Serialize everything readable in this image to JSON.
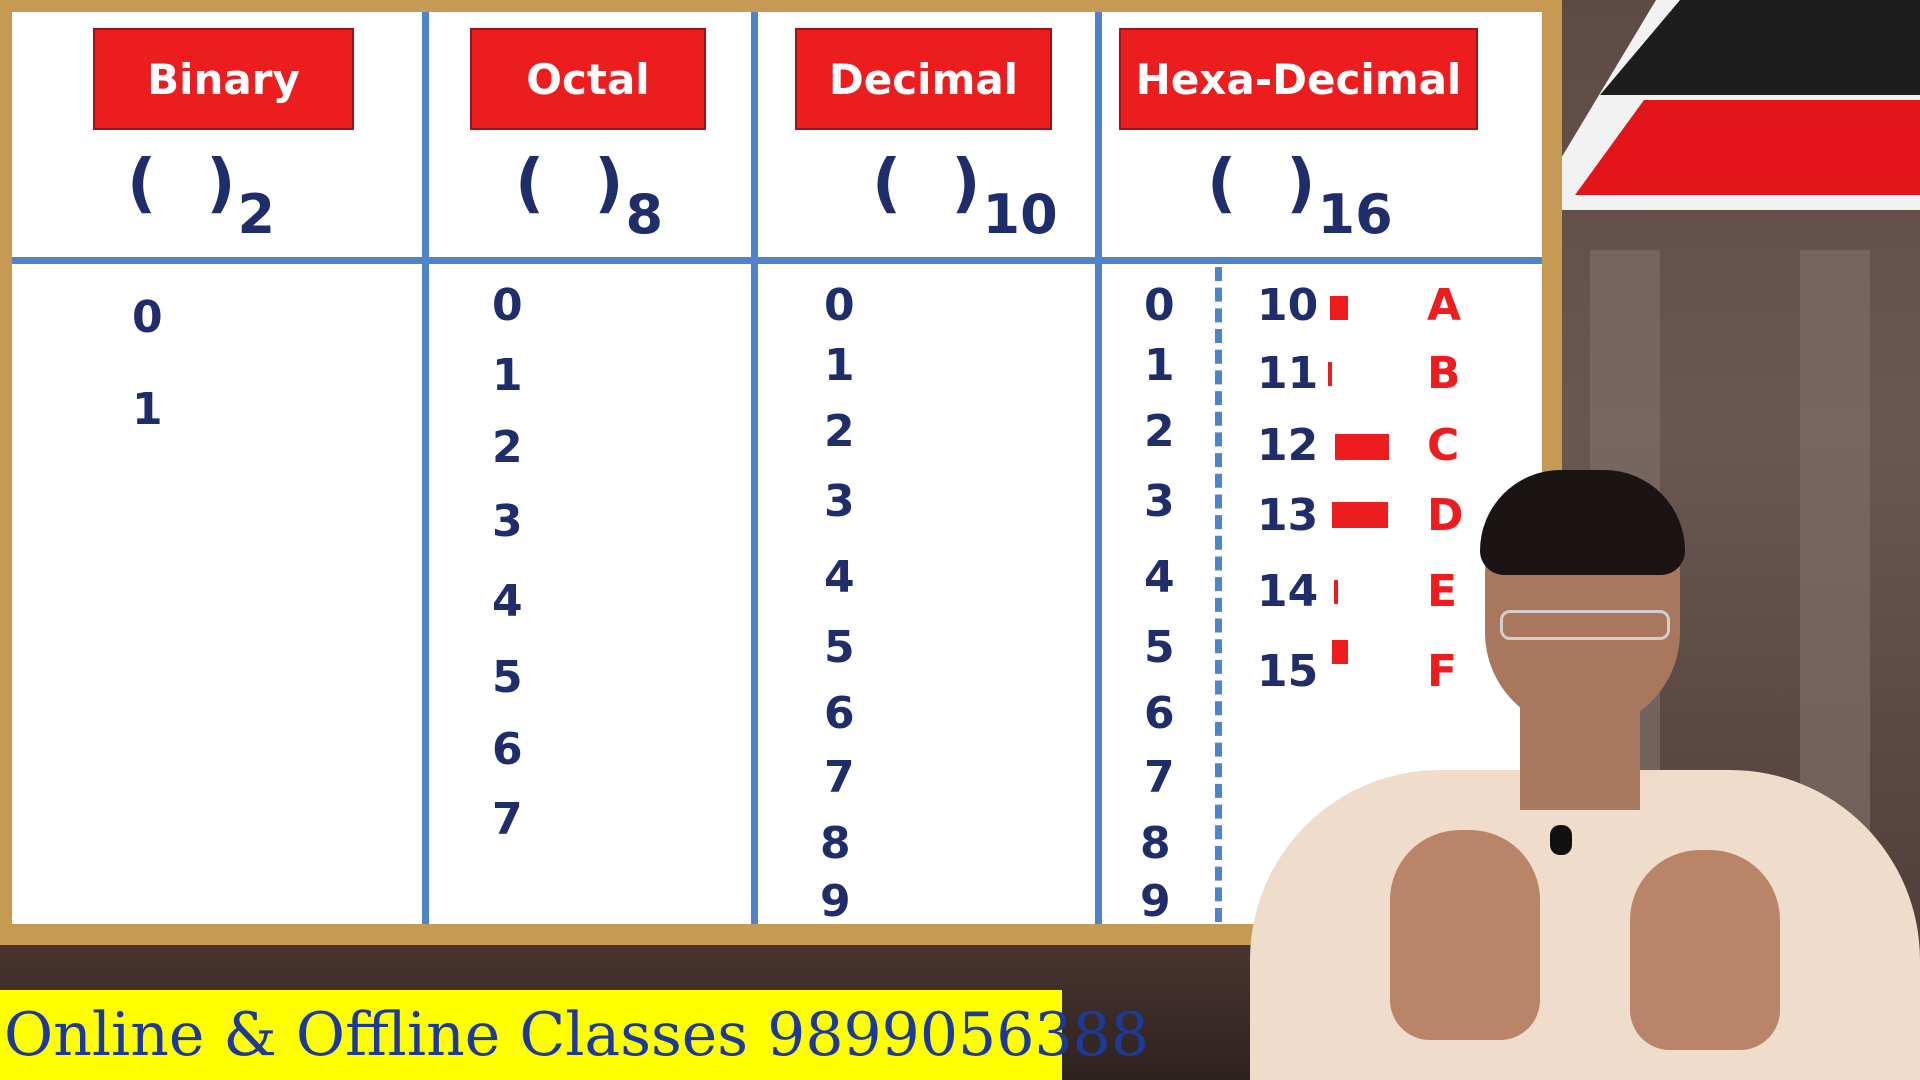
{
  "headers": {
    "binary": "Binary",
    "octal": "Octal",
    "decimal": "Decimal",
    "hex": "Hexa-Decimal"
  },
  "notation": {
    "open_paren": "(",
    "close_paren": ")",
    "binary_base": "2",
    "octal_base": "8",
    "decimal_base": "10",
    "hex_base": "16"
  },
  "binary_digits": [
    "0",
    "1"
  ],
  "octal_digits": [
    "0",
    "1",
    "2",
    "3",
    "4",
    "5",
    "6",
    "7"
  ],
  "decimal_digits": [
    "0",
    "1",
    "2",
    "3",
    "4",
    "5",
    "6",
    "7",
    "8",
    "9"
  ],
  "hex_digits": [
    "0",
    "1",
    "2",
    "3",
    "4",
    "5",
    "6",
    "7",
    "8",
    "9"
  ],
  "hex_extra": [
    {
      "value": "10",
      "letter": "A"
    },
    {
      "value": "11",
      "letter": "B"
    },
    {
      "value": "12",
      "letter": "C"
    },
    {
      "value": "13",
      "letter": "D"
    },
    {
      "value": "14",
      "letter": "E"
    },
    {
      "value": "15",
      "letter": "F"
    }
  ],
  "banner": {
    "text": "Online & Offline Classes 9899056388"
  },
  "colors": {
    "header_red": "#ed1c1f",
    "digit_navy": "#1f2d6b",
    "grid_blue": "#4f84c8",
    "banner_yellow": "#ffff00"
  }
}
